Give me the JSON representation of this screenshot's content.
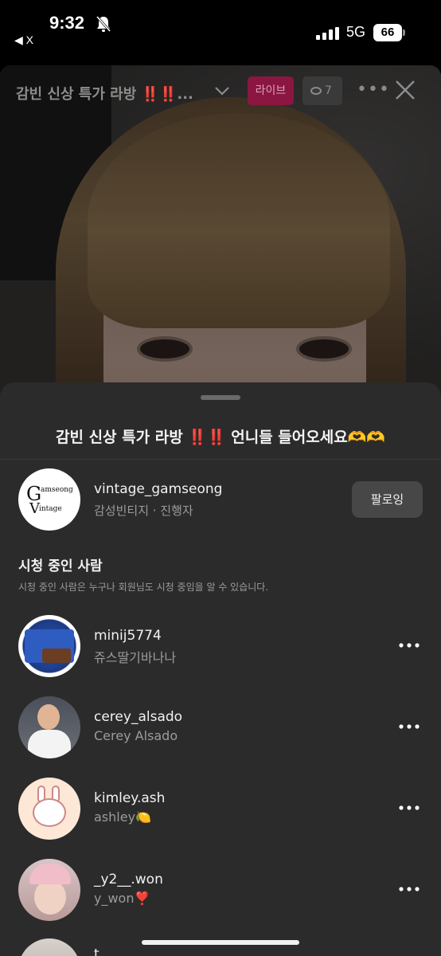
{
  "status_bar": {
    "time": "9:32",
    "back_app": "◀ X",
    "network": "5G",
    "battery": "66"
  },
  "live": {
    "title_truncated": "감빈 신상 특가 라방 ‼️‼️...",
    "live_badge": "라이브",
    "viewer_count": "7"
  },
  "sheet": {
    "title": "감빈 신상 특가 라방 ‼️‼️ 언니들 들어오세요🫶🫶",
    "host": {
      "logo_text": [
        "G",
        "amseong",
        "V",
        "intage"
      ],
      "username": "vintage_gamseong",
      "subtitle": "감성빈티지 · 진행자",
      "follow_label": "팔로잉"
    },
    "viewers_section": {
      "title": "시청 중인 사람",
      "note": "시청 중인 사람은 누구나 회원님도 시청 중임을 알 수 있습니다."
    },
    "viewers": [
      {
        "username": "minij5774",
        "display_name": "쥬스딸기바나나"
      },
      {
        "username": "cerey_alsado",
        "display_name": "Cerey Alsado"
      },
      {
        "username": "kimley.ash",
        "display_name": "ashley🍋"
      },
      {
        "username": "_y2__.won",
        "display_name": "y_won❣️"
      },
      {
        "username": "t",
        "display_name": ""
      }
    ]
  },
  "colors": {
    "live_badge_bg": "#8b1641",
    "sheet_bg": "#2b2b2b",
    "follow_bg": "#474747"
  }
}
